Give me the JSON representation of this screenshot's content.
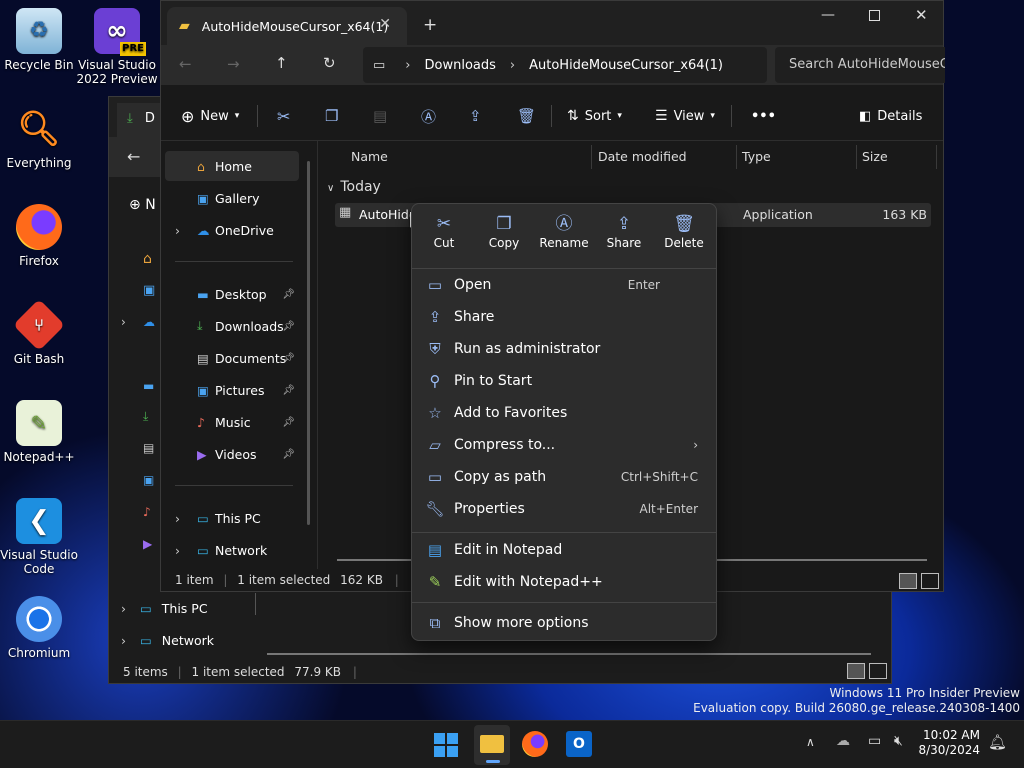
{
  "desktop": {
    "icons": [
      {
        "label": "Recycle Bin",
        "icon": "recycle-bin-icon"
      },
      {
        "label": "Visual Studio 2022 Preview",
        "icon": "visual-studio-icon",
        "badge": "PRE"
      },
      {
        "label": "Everything",
        "icon": "everything-search-icon"
      },
      {
        "label": "Firefox",
        "icon": "firefox-icon"
      },
      {
        "label": "Git Bash",
        "icon": "git-bash-icon"
      },
      {
        "label": "Notepad++",
        "icon": "notepadpp-icon"
      },
      {
        "label": "Visual Studio Code",
        "icon": "vscode-icon"
      },
      {
        "label": "Chromium",
        "icon": "chromium-icon"
      }
    ],
    "watermark": {
      "line1": "Windows 11 Pro Insider Preview",
      "line2": "Evaluation copy. Build 26080.ge_release.240308-1400"
    }
  },
  "back_window": {
    "tab_fragment": "D",
    "new_fragment": "N",
    "sidebar": [
      {
        "label": "This PC"
      },
      {
        "label": "Network"
      }
    ],
    "status": {
      "items": "5 items",
      "selected": "1 item selected",
      "size": "77.9 KB"
    }
  },
  "front_window": {
    "tab_title": "AutoHideMouseCursor_x64(1)",
    "breadcrumb": [
      "Downloads",
      "AutoHideMouseCursor_x64(1)"
    ],
    "search_placeholder": "Search AutoHideMouseC",
    "toolbar": {
      "new": "New",
      "sort": "Sort",
      "view": "View",
      "more": "•••",
      "details": "Details"
    },
    "sidebar": {
      "top": [
        {
          "label": "Home",
          "icon": "home-icon"
        },
        {
          "label": "Gallery",
          "icon": "gallery-icon"
        },
        {
          "label": "OneDrive",
          "icon": "onedrive-icon"
        }
      ],
      "pinned": [
        {
          "label": "Desktop",
          "icon": "desktop-folder-icon"
        },
        {
          "label": "Downloads",
          "icon": "downloads-icon"
        },
        {
          "label": "Documents",
          "icon": "documents-icon"
        },
        {
          "label": "Pictures",
          "icon": "pictures-icon"
        },
        {
          "label": "Music",
          "icon": "music-icon"
        },
        {
          "label": "Videos",
          "icon": "videos-icon"
        }
      ],
      "bottom": [
        {
          "label": "This PC",
          "icon": "this-pc-icon"
        },
        {
          "label": "Network",
          "icon": "network-icon"
        }
      ]
    },
    "columns": [
      "Name",
      "Date modified",
      "Type",
      "Size"
    ],
    "group": "Today",
    "file": {
      "name": "AutoHide",
      "type": "Application",
      "size": "163 KB"
    },
    "status": {
      "items": "1 item",
      "selected": "1 item selected",
      "size": "162 KB"
    }
  },
  "context_menu": {
    "top_actions": [
      {
        "label": "Cut",
        "icon": "cut-icon"
      },
      {
        "label": "Copy",
        "icon": "copy-icon"
      },
      {
        "label": "Rename",
        "icon": "rename-icon"
      },
      {
        "label": "Share",
        "icon": "share-icon"
      },
      {
        "label": "Delete",
        "icon": "delete-icon"
      }
    ],
    "items": [
      {
        "label": "Open",
        "shortcut": "Enter",
        "icon": "open-icon"
      },
      {
        "label": "Share",
        "shortcut": "",
        "icon": "share-icon"
      },
      {
        "label": "Run as administrator",
        "shortcut": "",
        "icon": "shield-icon"
      },
      {
        "label": "Pin to Start",
        "shortcut": "",
        "icon": "pin-icon"
      },
      {
        "label": "Add to Favorites",
        "shortcut": "",
        "icon": "star-icon"
      },
      {
        "label": "Compress to...",
        "shortcut": "",
        "icon": "archive-icon"
      },
      {
        "label": "Copy as path",
        "shortcut": "Ctrl+Shift+C",
        "icon": "path-icon"
      },
      {
        "label": "Properties",
        "shortcut": "Alt+Enter",
        "icon": "wrench-icon"
      }
    ],
    "app_items": [
      {
        "label": "Edit in Notepad",
        "icon": "notepad-icon"
      },
      {
        "label": "Edit with Notepad++",
        "icon": "notepadpp-icon"
      }
    ],
    "more": {
      "label": "Show more options",
      "icon": "more-options-icon"
    }
  },
  "taskbar": {
    "time": "10:02 AM",
    "date": "8/30/2024"
  },
  "colors": {
    "accent": "#60a5fa",
    "window_bg": "#191919",
    "menu_bg": "#2c2c2c"
  }
}
